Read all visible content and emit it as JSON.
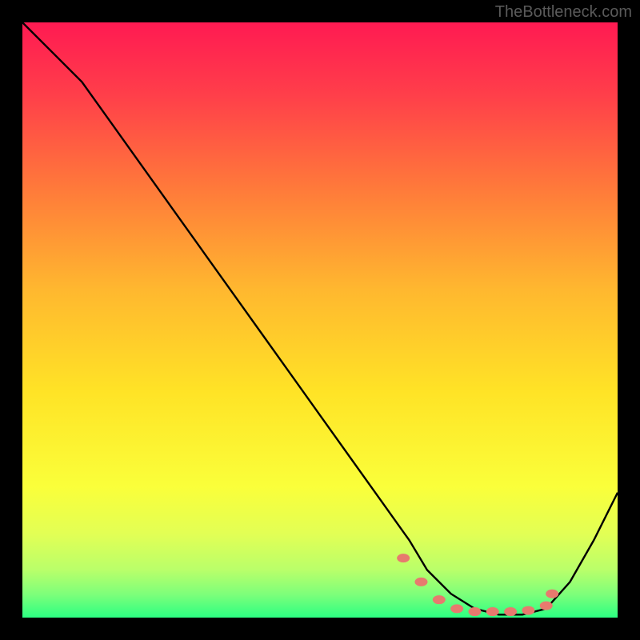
{
  "watermark": "TheBottleneck.com",
  "chart_data": {
    "type": "line",
    "title": "",
    "xlabel": "",
    "ylabel": "",
    "xlim": [
      0,
      100
    ],
    "ylim": [
      0,
      100
    ],
    "curve": {
      "name": "bottleneck-curve",
      "x": [
        0,
        5,
        10,
        15,
        20,
        25,
        30,
        35,
        40,
        45,
        50,
        55,
        60,
        65,
        68,
        72,
        76,
        80,
        84,
        88,
        92,
        96,
        100
      ],
      "y": [
        100,
        95,
        90,
        83,
        76,
        69,
        62,
        55,
        48,
        41,
        34,
        27,
        20,
        13,
        8,
        4,
        1.5,
        0.5,
        0.5,
        1.5,
        6,
        13,
        21
      ]
    },
    "markers": {
      "name": "highlight-dots",
      "x": [
        64,
        67,
        70,
        73,
        76,
        79,
        82,
        85,
        88,
        89
      ],
      "y": [
        10,
        6,
        3,
        1.5,
        1,
        1,
        1,
        1.2,
        2,
        4
      ]
    },
    "background_gradient": {
      "stops": [
        {
          "offset": 0.0,
          "color": "#ff1a52"
        },
        {
          "offset": 0.12,
          "color": "#ff3e4a"
        },
        {
          "offset": 0.28,
          "color": "#ff7a3a"
        },
        {
          "offset": 0.45,
          "color": "#ffb82f"
        },
        {
          "offset": 0.62,
          "color": "#ffe326"
        },
        {
          "offset": 0.78,
          "color": "#faff3a"
        },
        {
          "offset": 0.86,
          "color": "#e2ff55"
        },
        {
          "offset": 0.92,
          "color": "#b9ff6a"
        },
        {
          "offset": 0.96,
          "color": "#7fff7a"
        },
        {
          "offset": 1.0,
          "color": "#2cff82"
        }
      ]
    },
    "marker_color": "#e77a6e",
    "curve_color": "#000000"
  }
}
